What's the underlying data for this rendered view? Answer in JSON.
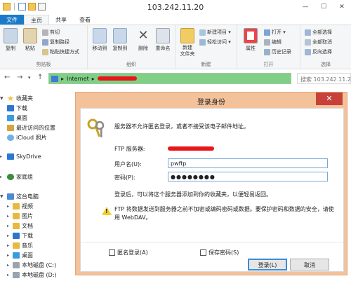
{
  "window": {
    "title": "103.242.11.20"
  },
  "win_controls": {
    "minimize": "—",
    "maximize": "☐",
    "close": "✕"
  },
  "ribbon": {
    "tabs": [
      {
        "label": "文件"
      },
      {
        "label": "主页"
      },
      {
        "label": "共享"
      },
      {
        "label": "查看"
      }
    ],
    "clipboard": {
      "copy": "复制",
      "paste": "粘贴",
      "cut": "剪切",
      "copy_path": "复制路径",
      "paste_shortcut": "粘贴快捷方式",
      "label": "剪贴板"
    },
    "organize": {
      "move_to": "移动到",
      "copy_to": "复制到",
      "delete": "删除",
      "rename": "重命名",
      "label": "组织"
    },
    "new": {
      "new_folder": "新建\n文件夹",
      "new_item": "新建项目 ▾",
      "easy_access": "轻松访问 ▾",
      "label": "新建"
    },
    "open": {
      "properties": "属性",
      "open": "打开 ▾",
      "edit": "编辑",
      "history": "历史记录",
      "label": "打开"
    },
    "select": {
      "select_all": "全部选择",
      "select_none": "全部取消",
      "invert": "反向选择",
      "label": "选择"
    }
  },
  "address": {
    "path": "Internet",
    "separator": "▸",
    "search_placeholder": "搜索 103.242.11.20"
  },
  "nav_buttons": {
    "back": "←",
    "forward": "→",
    "dropdown": "▾",
    "up": "↑"
  },
  "nav_pane": {
    "favorites": "收藏夹",
    "favorites_items": [
      "下载",
      "桌面",
      "最近访问的位置",
      "iCloud 照片"
    ],
    "skydrive": "SkyDrive",
    "homegroup": "家庭组",
    "this_pc": "这台电脑",
    "pc_items": [
      "视频",
      "图片",
      "文档",
      "下载",
      "音乐",
      "桌面",
      "本地磁盘 (C:)",
      "本地磁盘 (D:)"
    ]
  },
  "dialog": {
    "title": "登录身份",
    "close": "✕",
    "message": "服务器不允许匿名登录，或者不接受该电子邮件地址。",
    "ftp_server_label": "FTP 服务器:",
    "username_label": "用户名(U):",
    "username_value": "pwftp",
    "password_label": "密码(P):",
    "password_value": "●●●●●●●●",
    "info": "登录后，可以将这个服务器添加到你的收藏夹，以便轻易返回。",
    "warning_line1": "FTP 将数据发送到服务器之前不加密或编码密码或数据。要保护密码和数据的安全，请使",
    "warning_line2": "用 WebDAV。",
    "anonymous_label": "匿名登录(A)",
    "save_password_label": "保存密码(S)",
    "login_button": "登录(L)",
    "cancel_button": "取消"
  },
  "colors": {
    "file_tab": "#1979ca",
    "dialog_frame": "#f3c29a",
    "close_red": "#c7413a",
    "address_bg": "#7fd086",
    "redaction": "#e8161b"
  }
}
